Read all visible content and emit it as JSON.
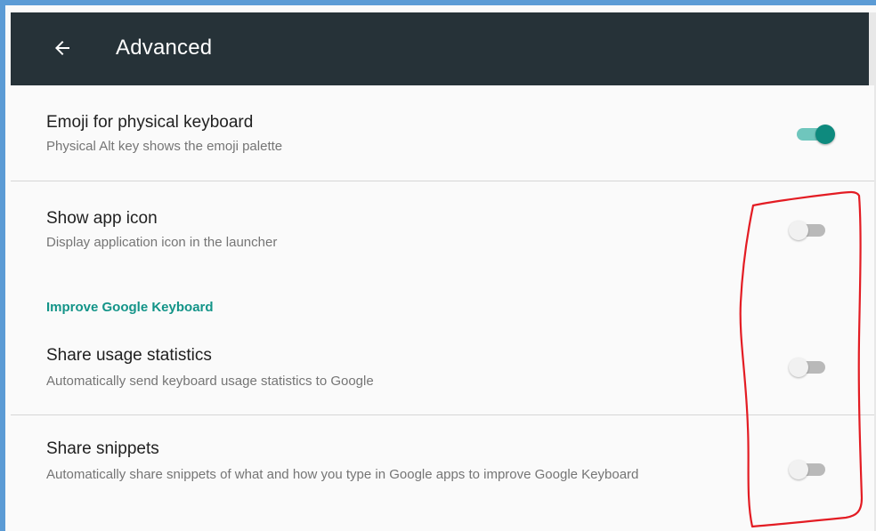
{
  "toolbar": {
    "title": "Advanced",
    "back_icon": "arrow-back-icon"
  },
  "settings": [
    {
      "title": "Emoji for physical keyboard",
      "subtitle": "Physical Alt key shows the emoji palette",
      "enabled": true
    },
    {
      "title": "Show app icon",
      "subtitle": "Display application icon in the launcher",
      "enabled": false
    },
    {
      "title": "Share usage statistics",
      "subtitle": "Automatically send keyboard usage statistics to Google",
      "enabled": false
    },
    {
      "title": "Share snippets",
      "subtitle": "Automatically share snippets of what and how you type in Google apps to improve Google Keyboard",
      "enabled": false
    }
  ],
  "section_header": "Improve Google Keyboard",
  "colors": {
    "toolbar": "#263238",
    "accent": "#139488",
    "switch_on_thumb": "#0e8a7e",
    "switch_on_track": "#6fc6bd",
    "annotation": "#e31c23",
    "frame": "#5b9bd5"
  }
}
